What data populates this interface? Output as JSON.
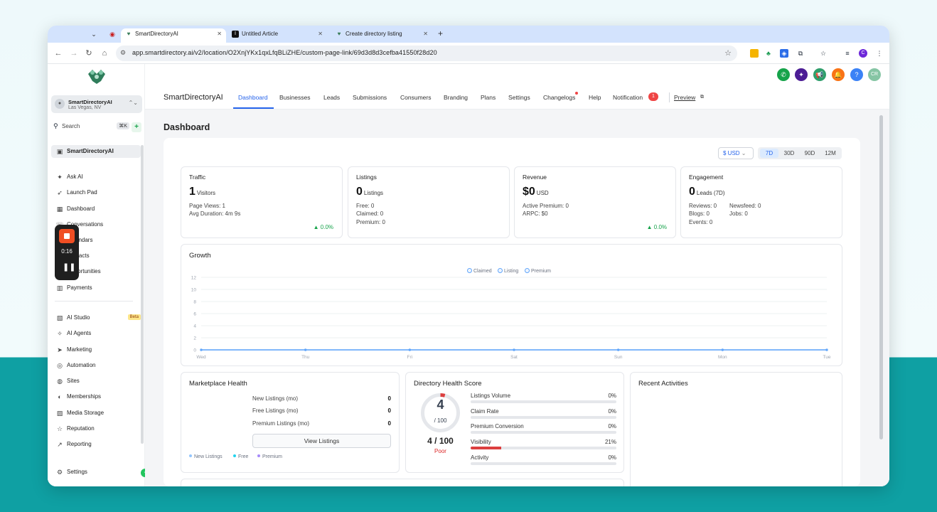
{
  "browser": {
    "tabs": [
      {
        "title": "SmartDirectoryAI",
        "active": true,
        "icon": "smartdirectory-favicon"
      },
      {
        "title": "Untitled Article",
        "active": false,
        "icon": "article-favicon"
      },
      {
        "title": "Create directory listing",
        "active": false,
        "icon": "smartdirectory-favicon"
      }
    ],
    "url": "app.smartdirectory.ai/v2/location/O2XnjYKx1qxLfqBLiZHE/custom-page-link/69d3d8d3cefba41550f28d20",
    "profile_initial": "C"
  },
  "recorder": {
    "time": "0:16"
  },
  "sidebar": {
    "account_name": "SmartDirectoryAI",
    "account_location": "Las Vegas, NV",
    "search_label": "Search",
    "search_shortcut": "⌘K",
    "section_title": "SmartDirectoryAI",
    "items": [
      {
        "label": "Ask AI",
        "icon": "sparkle-icon"
      },
      {
        "label": "Launch Pad",
        "icon": "rocket-icon"
      },
      {
        "label": "Dashboard",
        "icon": "dashboard-icon"
      },
      {
        "label": "Conversations",
        "icon": "chat-icon"
      },
      {
        "label": "Calendars",
        "icon": "calendar-icon"
      },
      {
        "label": "Contacts",
        "icon": "contacts-icon"
      },
      {
        "label": "Opportunities",
        "icon": "opportunities-icon"
      },
      {
        "label": "Payments",
        "icon": "payments-icon"
      }
    ],
    "items2": [
      {
        "label": "AI Studio",
        "icon": "ai-studio-icon",
        "badge": "Beta"
      },
      {
        "label": "AI Agents",
        "icon": "ai-agents-icon"
      },
      {
        "label": "Marketing",
        "icon": "send-icon"
      },
      {
        "label": "Automation",
        "icon": "automation-icon"
      },
      {
        "label": "Sites",
        "icon": "globe-icon"
      },
      {
        "label": "Memberships",
        "icon": "memberships-icon"
      },
      {
        "label": "Media Storage",
        "icon": "image-icon"
      },
      {
        "label": "Reputation",
        "icon": "star-icon"
      },
      {
        "label": "Reporting",
        "icon": "chart-icon"
      }
    ],
    "settings_label": "Settings"
  },
  "header": {
    "brand": "SmartDirectoryAI",
    "nav": [
      "Dashboard",
      "Businesses",
      "Leads",
      "Submissions",
      "Consumers",
      "Branding",
      "Plans",
      "Settings",
      "Changelogs",
      "Help",
      "Notification"
    ],
    "notification_count": "1",
    "preview_label": "Preview",
    "user_initials": "CR"
  },
  "dashboard": {
    "title": "Dashboard",
    "currency": "$ USD",
    "ranges": [
      "7D",
      "30D",
      "90D",
      "12M"
    ],
    "selected_range": "7D",
    "traffic": {
      "title": "Traffic",
      "value": "1",
      "unit": "Visitors",
      "lines": [
        "Page Views: 1",
        "Avg Duration: 4m 9s"
      ],
      "trend": "▲ 0.0%"
    },
    "listings": {
      "title": "Listings",
      "value": "0",
      "unit": "Listings",
      "lines": [
        "Free: 0",
        "Claimed: 0",
        "Premium: 0"
      ]
    },
    "revenue": {
      "title": "Revenue",
      "value": "$0",
      "unit": "USD",
      "lines": [
        "Active Premium: 0",
        "ARPC: $0"
      ],
      "trend": "▲ 0.0%"
    },
    "engagement": {
      "title": "Engagement",
      "value": "0",
      "unit": "Leads (7D)",
      "col1": [
        "Reviews: 0",
        "Blogs: 0",
        "Events: 0"
      ],
      "col2": [
        "Newsfeed: 0",
        "Jobs: 0"
      ]
    }
  },
  "chart_data": {
    "type": "line",
    "title": "Growth",
    "categories": [
      "Wed",
      "Thu",
      "Fri",
      "Sat",
      "Sun",
      "Mon",
      "Tue"
    ],
    "series": [
      {
        "name": "Claimed",
        "values": [
          0,
          0,
          0,
          0,
          0,
          0,
          0
        ]
      },
      {
        "name": "Listing",
        "values": [
          0,
          0,
          0,
          0,
          0,
          0,
          0
        ]
      },
      {
        "name": "Premium",
        "values": [
          0,
          0,
          0,
          0,
          0,
          0,
          0
        ]
      }
    ],
    "yticks": [
      "0",
      "2",
      "4",
      "6",
      "8",
      "10",
      "12"
    ],
    "ylim": [
      0,
      12
    ],
    "grid": true,
    "legend": "top-center",
    "line_color": "#60a5fa"
  },
  "marketplace": {
    "title": "Marketplace Health",
    "rows": [
      {
        "label": "New Listings (mo)",
        "value": "0"
      },
      {
        "label": "Free Listings (mo)",
        "value": "0"
      },
      {
        "label": "Premium Listings (mo)",
        "value": "0"
      }
    ],
    "button": "View Listings",
    "legend": [
      {
        "label": "New Listings",
        "color": "#93c5fd"
      },
      {
        "label": "Free",
        "color": "#22d3ee"
      },
      {
        "label": "Premium",
        "color": "#a78bfa"
      }
    ]
  },
  "health_score": {
    "title": "Directory Health Score",
    "score": "4",
    "score_denominator": "/ 100",
    "score_text": "4 / 100",
    "rating": "Poor",
    "score_fraction": 0.04,
    "metrics": [
      {
        "label": "Listings Volume",
        "pct": "0%",
        "fraction": 0
      },
      {
        "label": "Claim Rate",
        "pct": "0%",
        "fraction": 0
      },
      {
        "label": "Premium Conversion",
        "pct": "0%",
        "fraction": 0
      },
      {
        "label": "Visibility",
        "pct": "21%",
        "fraction": 0.21
      },
      {
        "label": "Activity",
        "pct": "0%",
        "fraction": 0
      }
    ]
  },
  "recent": {
    "title": "Recent Activities"
  }
}
